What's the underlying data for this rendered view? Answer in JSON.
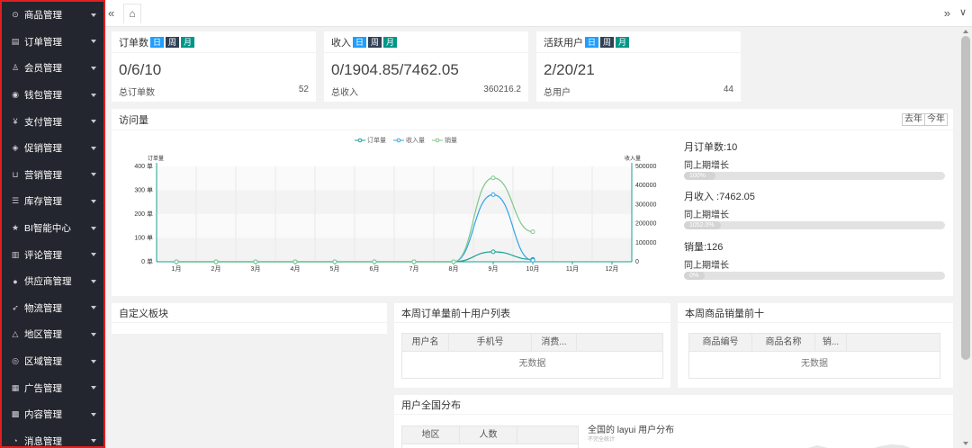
{
  "sidebar": {
    "items": [
      {
        "icon": "⊙",
        "label": "商品管理"
      },
      {
        "icon": "▤",
        "label": "订单管理"
      },
      {
        "icon": "♙",
        "label": "会员管理"
      },
      {
        "icon": "◉",
        "label": "钱包管理"
      },
      {
        "icon": "¥",
        "label": "支付管理"
      },
      {
        "icon": "◈",
        "label": "促销管理"
      },
      {
        "icon": "⊔",
        "label": "营销管理"
      },
      {
        "icon": "☰",
        "label": "库存管理"
      },
      {
        "icon": "★",
        "label": "BI智能中心"
      },
      {
        "icon": "▥",
        "label": "评论管理"
      },
      {
        "icon": "●",
        "label": "供应商管理"
      },
      {
        "icon": "➶",
        "label": "物流管理"
      },
      {
        "icon": "△",
        "label": "地区管理"
      },
      {
        "icon": "◎",
        "label": "区域管理"
      },
      {
        "icon": "▦",
        "label": "广告管理"
      },
      {
        "icon": "▩",
        "label": "内容管理"
      },
      {
        "icon": "◔",
        "label": "消息管理"
      }
    ]
  },
  "tabbar": {
    "left_icon": "«",
    "home_icon": "⌂",
    "right_icon": "»",
    "down_icon": "∨"
  },
  "stats": [
    {
      "title": "订单数",
      "tabs": [
        "日",
        "周",
        "月"
      ],
      "value": "0/6/10",
      "label": "总订单数",
      "total": "52"
    },
    {
      "title": "收入",
      "tabs": [
        "日",
        "周",
        "月"
      ],
      "value": "0/1904.85/7462.05",
      "label": "总收入",
      "total": "360216.2"
    },
    {
      "title": "活跃用户",
      "tabs": [
        "日",
        "周",
        "月"
      ],
      "value": "2/20/21",
      "label": "总用户",
      "total": "44"
    }
  ],
  "visits": {
    "title": "访问量",
    "year_buttons": [
      "去年",
      "今年"
    ],
    "metrics": [
      {
        "title": "月订单数:10",
        "sub": "同上期增长",
        "bar_text": "100%",
        "fill": 0.12
      },
      {
        "title": "月收入 :7462.05",
        "sub": "同上期增长",
        "bar_text": "1052.0%",
        "fill": 0.14
      },
      {
        "title": "销量:126",
        "sub": "同上期增长",
        "bar_text": "0%",
        "fill": 0.08
      }
    ]
  },
  "colors": {
    "orders": "#1aa094",
    "income": "#2fa4e7",
    "sales": "#7cc889",
    "primary_btn": "#1e9fff",
    "dark_btn": "#2f4056",
    "teal_btn": "#009688"
  },
  "chart_data": {
    "type": "line",
    "categories": [
      "1月",
      "2月",
      "3月",
      "4月",
      "5月",
      "6月",
      "7月",
      "8月",
      "9月",
      "10月",
      "11月",
      "12月"
    ],
    "series": [
      {
        "name": "订单量",
        "axis": "left",
        "values": [
          0,
          0,
          0,
          0,
          0,
          0,
          0,
          0,
          42,
          10,
          null,
          null
        ]
      },
      {
        "name": "收入量",
        "axis": "right",
        "values": [
          0,
          0,
          0,
          0,
          0,
          0,
          0,
          0,
          352000,
          7462,
          null,
          null
        ]
      },
      {
        "name": "销量",
        "axis": "left",
        "values": [
          0,
          0,
          0,
          0,
          0,
          0,
          0,
          0,
          352,
          126,
          null,
          null
        ]
      }
    ],
    "left_axis": {
      "label": "订单量",
      "ticks": [
        "0 单",
        "100 单",
        "200 单",
        "300 单",
        "400 单"
      ],
      "ylim": [
        0,
        400
      ]
    },
    "right_axis": {
      "label": "收入量",
      "ticks": [
        "0",
        "100000",
        "200000",
        "300000",
        "400000",
        "500000"
      ],
      "ylim": [
        0,
        500000
      ]
    },
    "legend": "top-center",
    "grid": true
  },
  "custom_block": {
    "title": "自定义板块"
  },
  "top_users": {
    "title": "本周订单量前十用户列表",
    "columns": [
      "用户名",
      "手机号",
      "消费..."
    ],
    "empty": "无数据"
  },
  "top_products": {
    "title": "本周商品销量前十",
    "columns": [
      "商品编号",
      "商品名称",
      "销..."
    ],
    "empty": "无数据"
  },
  "distribution": {
    "title": "用户全国分布",
    "columns": [
      "地区",
      "人数"
    ],
    "map_title": "全国的 layui 用户分布",
    "map_sub": "不完全统计"
  }
}
